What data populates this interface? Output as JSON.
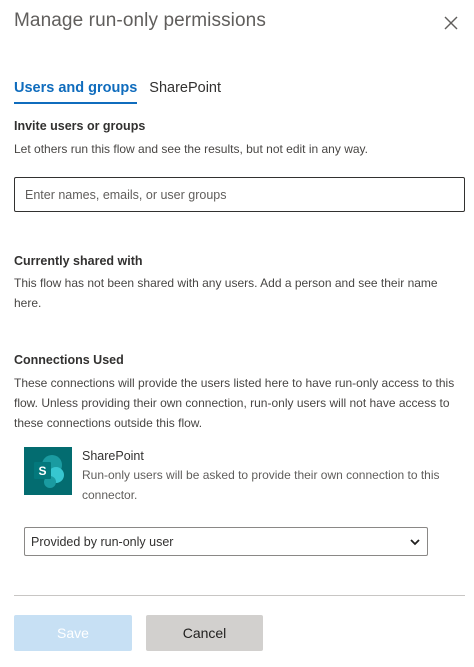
{
  "dialog": {
    "title": "Manage run-only permissions",
    "close_icon": "close-icon"
  },
  "tabs": [
    {
      "label": "Users and groups",
      "active": true
    },
    {
      "label": "SharePoint",
      "active": false
    }
  ],
  "invite": {
    "heading": "Invite users or groups",
    "description": "Let others run this flow and see the results, but not edit in any way.",
    "placeholder": "Enter names, emails, or user groups",
    "value": ""
  },
  "shared": {
    "heading": "Currently shared with",
    "description": "This flow has not been shared with any users. Add a person and see their name here."
  },
  "connections": {
    "heading": "Connections Used",
    "description": "These connections will provide the users listed here to have run-only access to this flow. Unless providing their own connection, run-only users will not have access to these connections outside this flow.",
    "items": [
      {
        "name": "SharePoint",
        "icon": "sharepoint-logo",
        "logo_letter": "S",
        "description": "Run-only users will be asked to provide their own connection to this connector.",
        "selected_option": "Provided by run-only user"
      }
    ]
  },
  "footer": {
    "save_label": "Save",
    "cancel_label": "Cancel",
    "save_enabled": false
  },
  "colors": {
    "accent": "#0f6cbd",
    "save_disabled_bg": "#c7e0f4",
    "cancel_bg": "#d2d0ce",
    "sharepoint_teal": "#036c70"
  }
}
